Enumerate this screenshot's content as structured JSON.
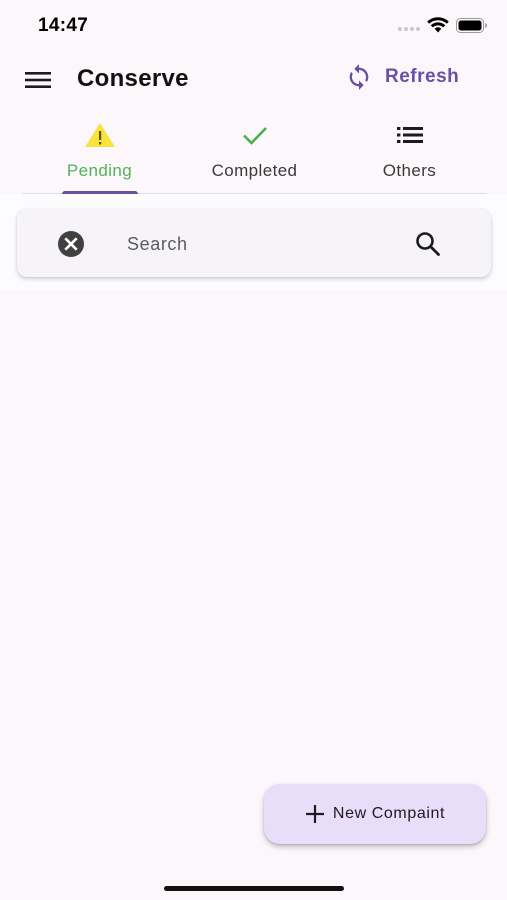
{
  "status_bar": {
    "time": "14:47"
  },
  "app_bar": {
    "title": "Conserve",
    "refresh_label": "Refresh",
    "accent_color": "#6750a4"
  },
  "tabs": [
    {
      "label": "Pending",
      "icon": "warning-icon",
      "active": true,
      "icon_color": "#f7e33b"
    },
    {
      "label": "Completed",
      "icon": "check-icon",
      "active": false,
      "icon_color": "#4caf50"
    },
    {
      "label": "Others",
      "icon": "list-icon",
      "active": false,
      "icon_color": "#1c1b1f"
    }
  ],
  "search": {
    "placeholder": "Search",
    "value": "",
    "clear_icon": "clear-circle-icon",
    "search_icon": "search-icon"
  },
  "fab": {
    "label": "New Compaint",
    "icon": "plus-icon",
    "background": "#eaddfa"
  }
}
